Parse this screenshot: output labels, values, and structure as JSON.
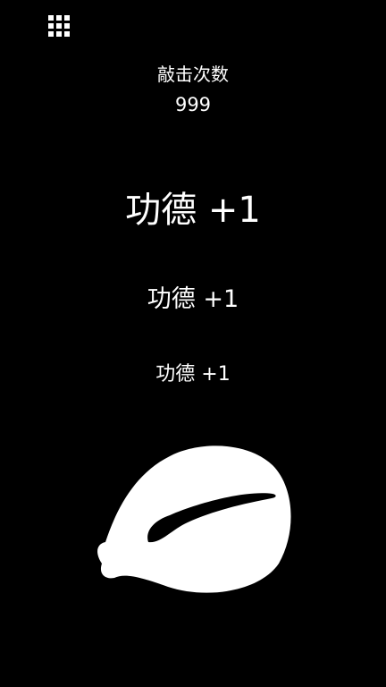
{
  "menu": {
    "icon": "grid-icon"
  },
  "counter": {
    "label": "敲击次数",
    "value": "999"
  },
  "merits": [
    {
      "text": "功德 +1"
    },
    {
      "text": "功德 +1"
    },
    {
      "text": "功德 +1"
    }
  ],
  "wooden_fish": {
    "icon": "wooden-fish-icon"
  },
  "colors": {
    "background": "#000000",
    "foreground": "#ffffff"
  }
}
